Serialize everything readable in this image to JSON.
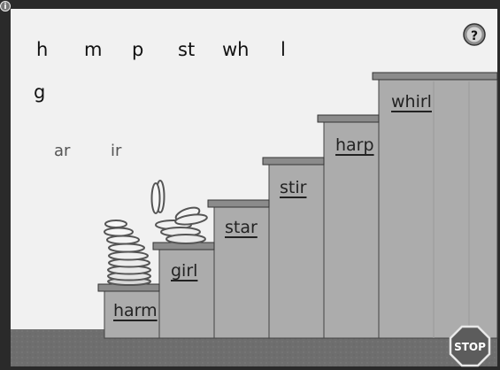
{
  "consonants": [
    "h",
    "m",
    "p",
    "st",
    "wh",
    "l",
    "g"
  ],
  "vowel_choices": [
    "ar",
    "ir"
  ],
  "step_words": [
    "harm",
    "girl",
    "star",
    "stir",
    "harp",
    "whirl"
  ],
  "buttons": {
    "help_icon": "?",
    "stop_label": "STOP"
  },
  "colors": {
    "sky": "#f1f1f1",
    "border": "#2a2a2a",
    "step_face": "#ababab",
    "step_top": "#8a8a8a",
    "ground": "#6f6f6f",
    "stop_sign": "#5a5a5a"
  }
}
